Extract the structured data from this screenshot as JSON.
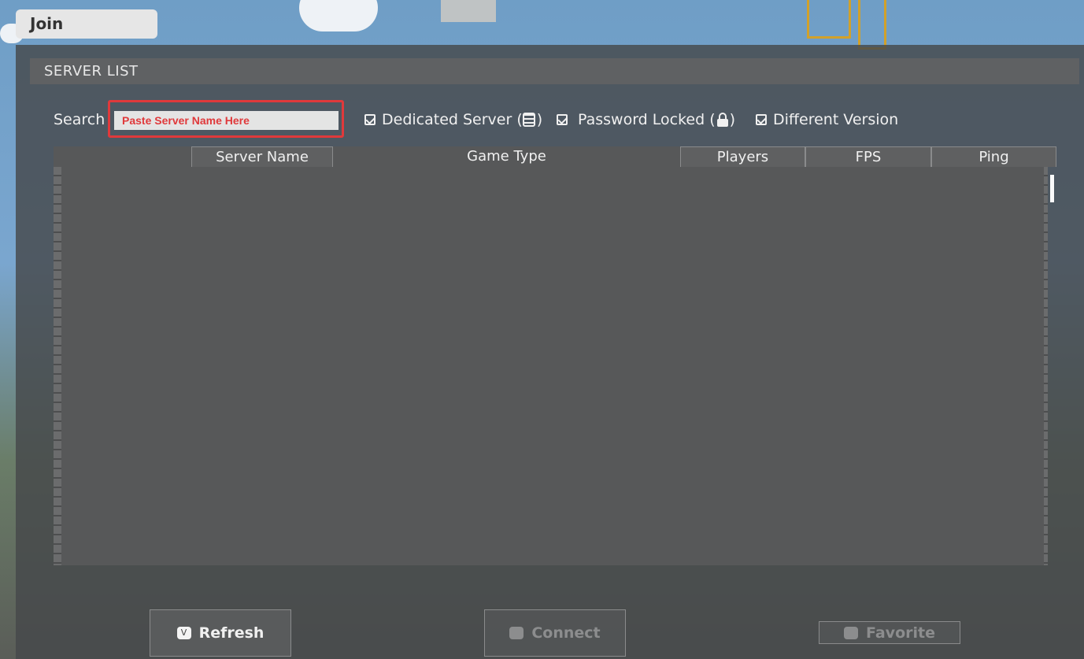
{
  "tab": {
    "label": "Join"
  },
  "panel": {
    "title": "SERVER LIST"
  },
  "search": {
    "label": "Search",
    "placeholder": "Paste Server Name Here"
  },
  "filters": [
    {
      "label": "Dedicated Server (",
      "icon": "server-icon",
      "suffix": ")",
      "checked": true
    },
    {
      "label": "Password Locked (",
      "icon": "lock-icon",
      "suffix": ")",
      "checked": true
    },
    {
      "label": "Different Version",
      "checked": true
    }
  ],
  "table": {
    "columns": [
      "Server Name",
      "Game Type",
      "Players",
      "FPS",
      "Ping"
    ],
    "rows": []
  },
  "buttons": {
    "refresh": {
      "label": "Refresh",
      "key": "V"
    },
    "connect": {
      "label": "Connect"
    },
    "favorite": {
      "label": "Favorite"
    }
  },
  "colors": {
    "highlight": "#e0393b"
  }
}
